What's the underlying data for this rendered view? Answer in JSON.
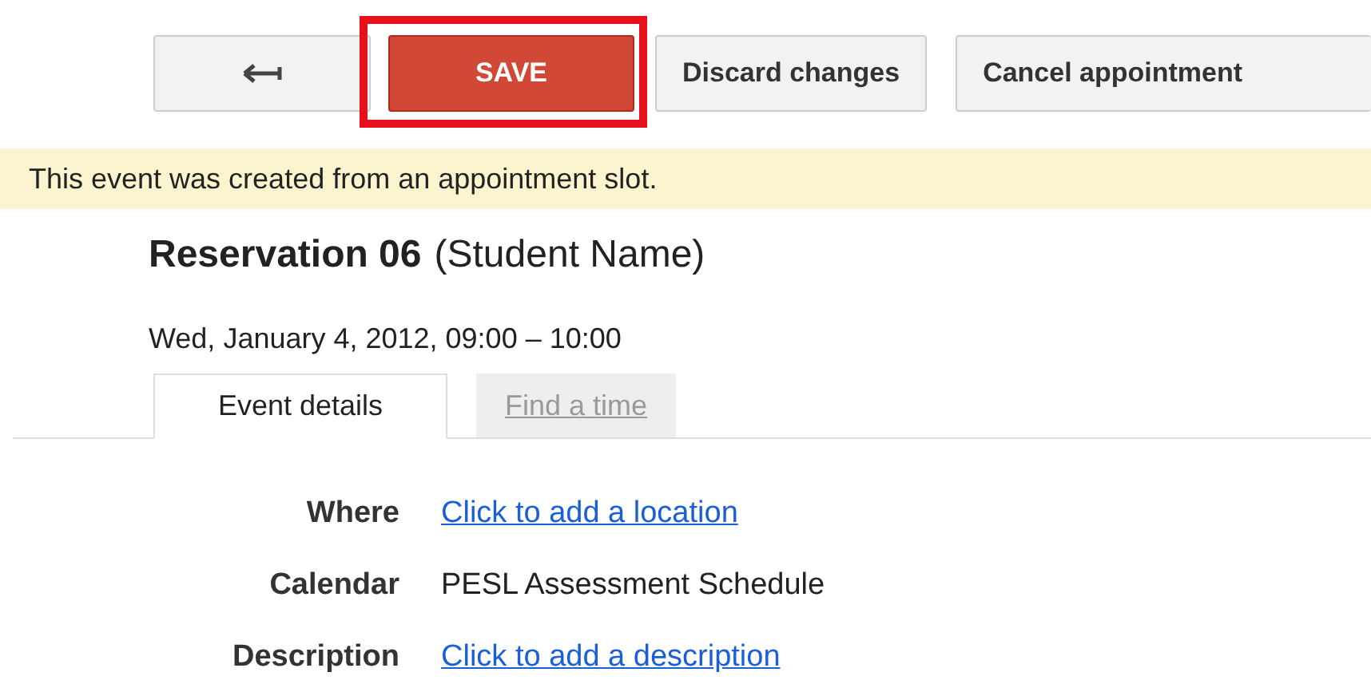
{
  "toolbar": {
    "buttons": [
      {
        "kind": "back",
        "highlighted": false
      },
      {
        "kind": "primary",
        "label": "SAVE",
        "highlighted": true
      },
      {
        "kind": "default",
        "label": "Discard changes",
        "highlighted": false
      },
      {
        "kind": "default",
        "label": "Cancel appointment",
        "highlighted": false
      }
    ]
  },
  "banner": "This event was created from an appointment slot.",
  "event": {
    "title": "Reservation 06",
    "subtitle": "(Student Name)",
    "datetime": "Wed, January 4, 2012, 09:00 – 10:00"
  },
  "tabs": [
    {
      "label": "Event details",
      "selected": true
    },
    {
      "label": "Find a time",
      "selected": false
    }
  ],
  "fields": [
    {
      "label": "Where",
      "kind": "link",
      "value": "Click to add a location"
    },
    {
      "label": "Calendar",
      "kind": "text",
      "value": "PESL Assessment Schedule"
    },
    {
      "label": "Description",
      "kind": "link",
      "value": "Click to add a description"
    }
  ]
}
